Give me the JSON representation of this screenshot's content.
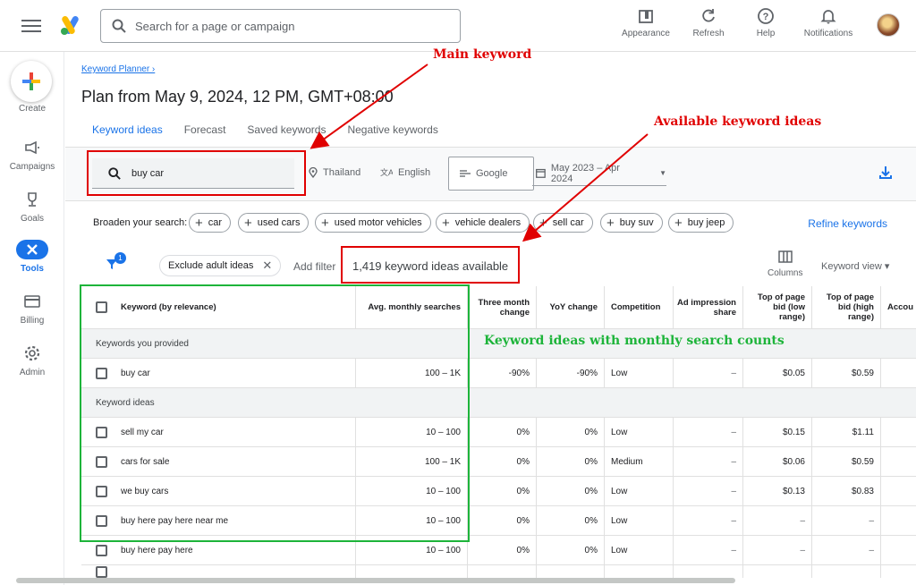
{
  "topbar": {
    "search_placeholder": "Search for a page or campaign",
    "actions": [
      {
        "label": "Appearance",
        "icon": "appearance-icon"
      },
      {
        "label": "Refresh",
        "icon": "refresh-icon"
      },
      {
        "label": "Help",
        "icon": "help-icon"
      },
      {
        "label": "Notifications",
        "icon": "bell-icon"
      }
    ]
  },
  "rail": {
    "create": "Create",
    "items": [
      {
        "label": "Campaigns",
        "icon": "megaphone-icon"
      },
      {
        "label": "Goals",
        "icon": "trophy-icon"
      },
      {
        "label": "Tools",
        "icon": "tools-icon"
      },
      {
        "label": "Billing",
        "icon": "card-icon"
      },
      {
        "label": "Admin",
        "icon": "gear-icon"
      }
    ]
  },
  "page": {
    "breadcrumb": "Keyword Planner ›",
    "title": "Plan from May 9, 2024, 12 PM, GMT+08:00",
    "tabs": [
      "Keyword ideas",
      "Forecast",
      "Saved keywords",
      "Negative keywords"
    ]
  },
  "filters": {
    "keyword": "buy car",
    "location": "Thailand",
    "language": "English",
    "network": "Google",
    "date_range": "May 2023 – Apr 2024"
  },
  "broaden": {
    "label": "Broaden your search:",
    "chips": [
      "car",
      "used cars",
      "used motor vehicles",
      "vehicle dealers",
      "sell car",
      "buy suv",
      "buy jeep"
    ],
    "refine": "Refine keywords"
  },
  "toolbar": {
    "filter_badge": "1",
    "adult_chip": "Exclude adult ideas",
    "add_filter": "Add filter",
    "ideas_count": "1,419 keyword ideas available",
    "columns": "Columns",
    "keyword_view": "Keyword view ▾"
  },
  "table": {
    "headers": {
      "keyword": "Keyword (by relevance)",
      "avg": "Avg. monthly searches",
      "three_line1": "Three month",
      "three_line2": "change",
      "yoy": "YoY change",
      "competition": "Competition",
      "ad_line1": "Ad impression",
      "ad_line2": "share",
      "low_line1": "Top of page",
      "low_line2": "bid (low",
      "low_line3": "range)",
      "high_line1": "Top of page",
      "high_line2": "bid (high",
      "high_line3": "range)",
      "account": "Accou"
    },
    "section_provided": "Keywords you provided",
    "section_ideas": "Keyword ideas",
    "provided": [
      {
        "keyword": "buy car",
        "avg": "100 – 1K",
        "three": "-90%",
        "yoy": "-90%",
        "comp": "Low",
        "ad": "–",
        "low": "$0.05",
        "high": "$0.59"
      }
    ],
    "ideas": [
      {
        "keyword": "sell my car",
        "avg": "10 – 100",
        "three": "0%",
        "yoy": "0%",
        "comp": "Low",
        "ad": "–",
        "low": "$0.15",
        "high": "$1.11"
      },
      {
        "keyword": "cars for sale",
        "avg": "100 – 1K",
        "three": "0%",
        "yoy": "0%",
        "comp": "Medium",
        "ad": "–",
        "low": "$0.06",
        "high": "$0.59"
      },
      {
        "keyword": "we buy cars",
        "avg": "10 – 100",
        "three": "0%",
        "yoy": "0%",
        "comp": "Low",
        "ad": "–",
        "low": "$0.13",
        "high": "$0.83"
      },
      {
        "keyword": "buy here pay here near me",
        "avg": "10 – 100",
        "three": "0%",
        "yoy": "0%",
        "comp": "Low",
        "ad": "–",
        "low": "–",
        "high": "–"
      },
      {
        "keyword": "buy here pay here",
        "avg": "10 – 100",
        "three": "0%",
        "yoy": "0%",
        "comp": "Low",
        "ad": "–",
        "low": "–",
        "high": "–"
      }
    ]
  },
  "annotations": {
    "main_keyword": "Main keyword",
    "available_ideas": "Available keyword ideas",
    "monthly_counts": "Keyword ideas with monthly search counts",
    "red_color": "#e00000",
    "green_color": "#1db43a"
  }
}
